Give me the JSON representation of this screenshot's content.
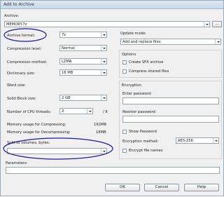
{
  "window": {
    "title": "Add to Archive"
  },
  "archive": {
    "label": "Archive:",
    "path": "MEMORY.7z",
    "browse": "..."
  },
  "left": {
    "archive_format": {
      "label": "Archive format:",
      "value": "7z"
    },
    "compression_level": {
      "label": "Compression level:",
      "value": "Normal"
    },
    "compression_method": {
      "label": "Compression method:",
      "value": "LZMA"
    },
    "dictionary_size": {
      "label": "Dictionary size:",
      "value": "16 MB"
    },
    "word_size": {
      "label": "Word size:",
      "value": ""
    },
    "solid_block": {
      "label": "Solid Block size:",
      "value": "2 GB"
    },
    "cpu_threads": {
      "label": "Number of CPU threads:",
      "value": "2",
      "max": "/ 8"
    },
    "mem_compress": {
      "label": "Memory usage for Compressing:",
      "value": "192MB"
    },
    "mem_decompress": {
      "label": "Memory usage for Decompressing:",
      "value": "18MB"
    },
    "split": {
      "label": "Split to volumes, bytes:",
      "value": ""
    },
    "parameters": {
      "label": "Parameters:",
      "value": ""
    }
  },
  "right": {
    "update_mode": {
      "label": "Update mode:",
      "value": "Add and replace files"
    },
    "options": {
      "title": "Options",
      "sfx": "Create SFX archive",
      "shared": "Compress shared files"
    },
    "encryption": {
      "title": "Encryption",
      "enter_password": "Enter password:",
      "reenter_password": "Reenter password:",
      "show_password": "Show Password",
      "method_label": "Encryption method:",
      "method_value": "AES-256",
      "encrypt_names": "Encrypt file names"
    }
  },
  "buttons": {
    "ok": "OK",
    "cancel": "Cancel",
    "help": "Help"
  },
  "colors": {
    "annotation": "#1a1aa8"
  }
}
